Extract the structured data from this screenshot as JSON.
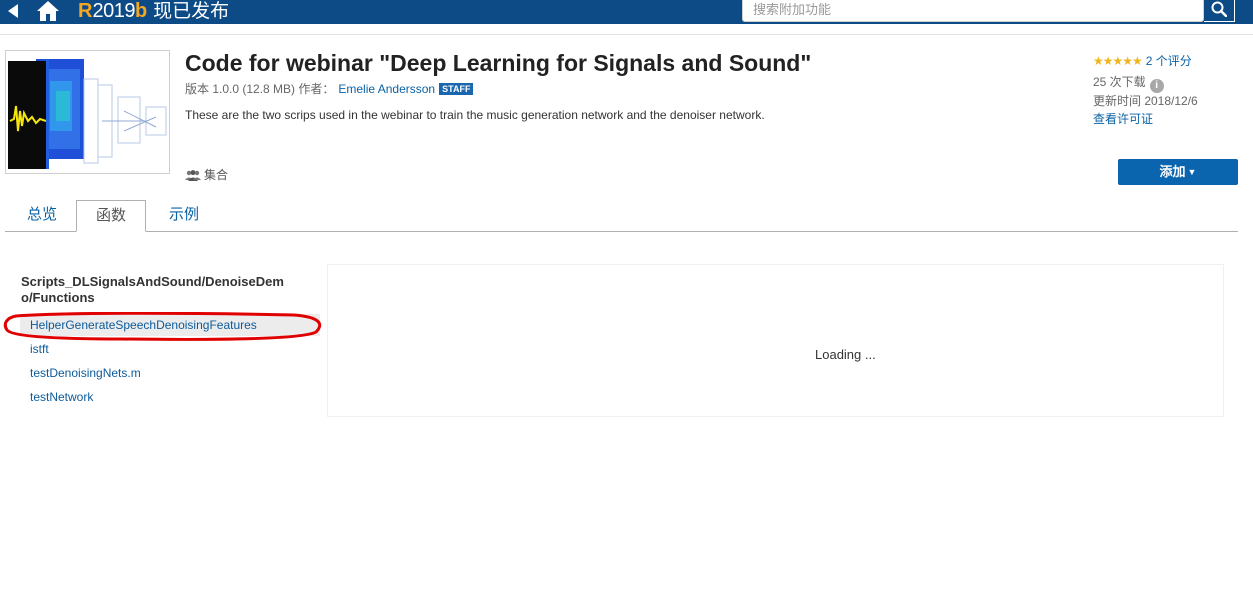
{
  "topbar": {
    "brand_r": "R",
    "brand_version": "2019",
    "brand_b": "b",
    "brand_text": "现已发布",
    "search_placeholder": "搜索附加功能"
  },
  "header": {
    "title": "Code for webinar \"Deep Learning for Signals and Sound\"",
    "version_text": "版本 1.0.0 (12.8 MB) 作者：",
    "author": "Emelie Andersson",
    "staff_badge": "STAFF",
    "description": "These are the two scrips used in the webinar to train the music generation network and the denoiser network.",
    "collection": "集合"
  },
  "sidebar_info": {
    "stars": "★★★★★",
    "rating_count": "2 个评分",
    "downloads": "25 次下载",
    "info_icon": "i",
    "updated": "更新时间 2018/12/6",
    "license": "查看许可证",
    "add_button": "添加",
    "add_caret": "▼"
  },
  "tabs": [
    {
      "label": "总览"
    },
    {
      "label": "函数"
    },
    {
      "label": "示例"
    }
  ],
  "functions": {
    "folder": "Scripts_DLSignalsAndSound/DenoiseDemo/Functions",
    "items": [
      {
        "label": "HelperGenerateSpeechDenoisingFeatures"
      },
      {
        "label": "istft"
      },
      {
        "label": "testDenoisingNets.m"
      },
      {
        "label": "testNetwork"
      }
    ]
  },
  "panel": {
    "loading": "Loading ..."
  },
  "colors": {
    "topbar": "#0d4b86",
    "link": "#0b62a3",
    "button": "#0b64ae",
    "stars": "#f0b41c",
    "highlight": "#e00000"
  }
}
